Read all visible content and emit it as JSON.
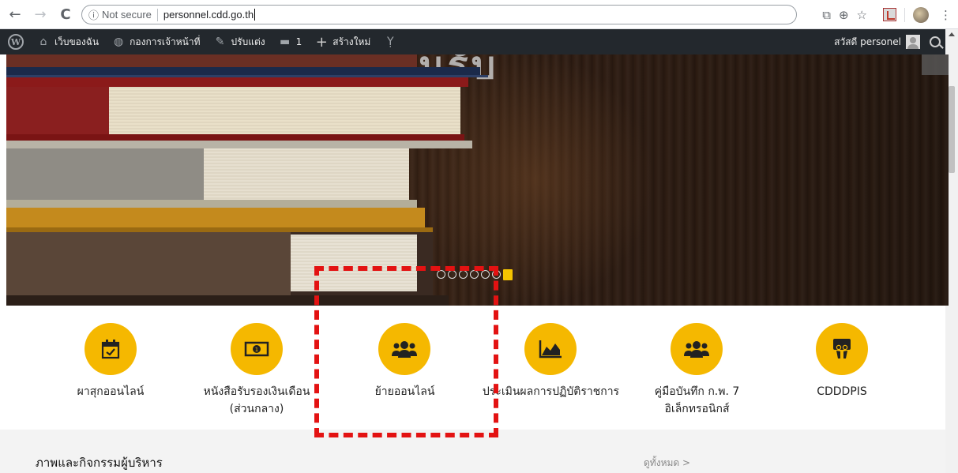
{
  "browser": {
    "back": "←",
    "forward": "→",
    "reload": "C",
    "security_label": "Not secure",
    "url": "personnel.cdd.go.th",
    "info_glyph": "ⓘ",
    "translate_glyph": "⧉",
    "zoom_glyph": "⊕",
    "star_glyph": "☆",
    "menu_glyph": "⋮"
  },
  "adminbar": {
    "wp_glyph": "W",
    "items": [
      {
        "label": "เว็บของฉัน",
        "icon": "home-icon",
        "glyph": "⌂"
      },
      {
        "label": "กองการเจ้าหน้าที่",
        "icon": "dashboard-icon",
        "glyph": "◍"
      },
      {
        "label": "ปรับแต่ง",
        "icon": "brush-icon",
        "glyph": "✎"
      },
      {
        "label": "1",
        "icon": "comment-icon",
        "glyph": "▬"
      },
      {
        "label": "สร้างใหม่",
        "icon": "plus-icon",
        "glyph": "+"
      },
      {
        "label": "",
        "icon": "yoast-icon",
        "glyph": "Ỵ"
      }
    ],
    "greeting": "สวัสดี personel"
  },
  "hero": {
    "title": "ยินดีต้อนรับ",
    "slide_count": 7,
    "active_slide": 7
  },
  "tiles": [
    {
      "label_lines": [
        "ผาสุกออนไลน์"
      ],
      "icon": "calendar-check-icon"
    },
    {
      "label_lines": [
        "หนังสือรับรองเงินเดือน",
        "(ส่วนกลาง)"
      ],
      "icon": "money-icon"
    },
    {
      "label_lines": [
        "ย้ายออนไลน์"
      ],
      "icon": "users-icon"
    },
    {
      "label_lines": [
        "ประเมินผลการปฏิบัติราชการ"
      ],
      "icon": "area-chart-icon"
    },
    {
      "label_lines": [
        "คู่มือบันทึก ก.พ. 7",
        "อิเล็กทรอนิกส์"
      ],
      "icon": "users-icon"
    },
    {
      "label_lines": [
        "CDDDPIS"
      ],
      "icon": "slideshare-icon"
    }
  ],
  "section": {
    "title": "ภาพและกิจกรรมผู้บริหาร",
    "see_all": "ดูทั้งหมด >"
  },
  "colors": {
    "accent": "#f5b800",
    "adminbar": "#23282d",
    "annotation": "#e31212",
    "active_dot": "#f5c400"
  }
}
